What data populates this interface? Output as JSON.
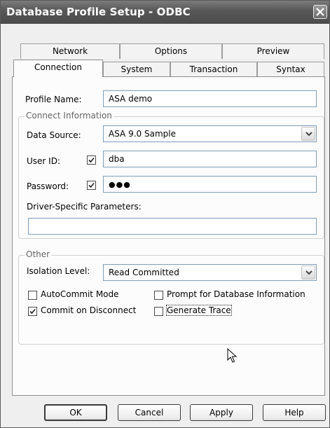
{
  "window": {
    "title": "Database Profile Setup - ODBC"
  },
  "tabs_back": [
    "Network",
    "Options",
    "Preview"
  ],
  "tabs_front": [
    "Connection",
    "System",
    "Transaction",
    "Syntax"
  ],
  "profile": {
    "label": "Profile Name:",
    "value": "ASA demo"
  },
  "connect_info": {
    "title": "Connect Information",
    "data_source_label": "Data Source:",
    "data_source_value": "ASA 9.0 Sample",
    "user_id_label": "User ID:",
    "user_id_checked": true,
    "user_id_value": "dba",
    "password_label": "Password:",
    "password_checked": true,
    "password_value": "●●●",
    "driver_params_label": "Driver-Specific Parameters:",
    "driver_params_value": ""
  },
  "other": {
    "title": "Other",
    "isolation_label": "Isolation Level:",
    "isolation_value": "Read Committed",
    "autocommit_label": "AutoCommit Mode",
    "autocommit_checked": false,
    "prompt_label": "Prompt for Database Information",
    "prompt_checked": false,
    "commit_disconnect_label": "Commit on Disconnect",
    "commit_disconnect_checked": true,
    "generate_trace_label": "Generate Trace",
    "generate_trace_checked": false
  },
  "buttons": {
    "ok": "OK",
    "cancel": "Cancel",
    "apply": "Apply",
    "help": "Help"
  },
  "icons": {
    "close": "close-icon",
    "dropdown": "chevron-down-icon",
    "check": "checkmark-icon",
    "cursor": "mouse-pointer-icon"
  },
  "colors": {
    "titlebar": "#565656",
    "dialog_bg": "#efefef",
    "field_border": "#7f9db9"
  }
}
